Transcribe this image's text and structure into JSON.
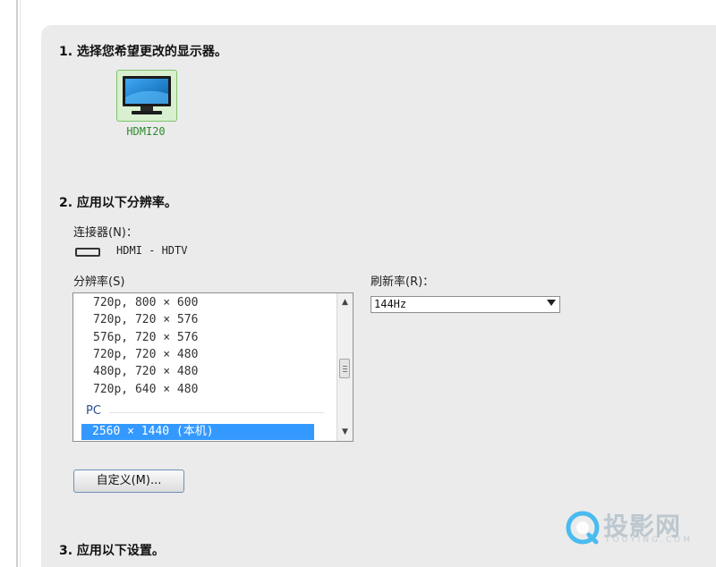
{
  "sections": {
    "s1": "1. 选择您希望更改的显示器。",
    "s2": "2. 应用以下分辨率。",
    "s3": "3. 应用以下设置。"
  },
  "display": {
    "name": "HDMI20"
  },
  "connector": {
    "label": "连接器(N)：",
    "value": "HDMI - HDTV"
  },
  "resolution": {
    "label": "分辨率(S)",
    "items": [
      "720p, 800 × 600",
      "720p, 720 × 576",
      "576p, 720 × 576",
      "720p, 720 × 480",
      "480p, 720 × 480",
      "720p, 640 × 480"
    ],
    "group": "PC",
    "selected": "2560 × 1440 (本机)"
  },
  "refresh": {
    "label": "刷新率(R)：",
    "value": "144Hz"
  },
  "custom_button": "自定义(M)...",
  "watermark": {
    "main": "投影网",
    "sub": "TOUYING.COM"
  },
  "colors": {
    "selection": "#3399ff",
    "monitor_label": "#2c8a2c",
    "panel": "#ebebeb"
  }
}
